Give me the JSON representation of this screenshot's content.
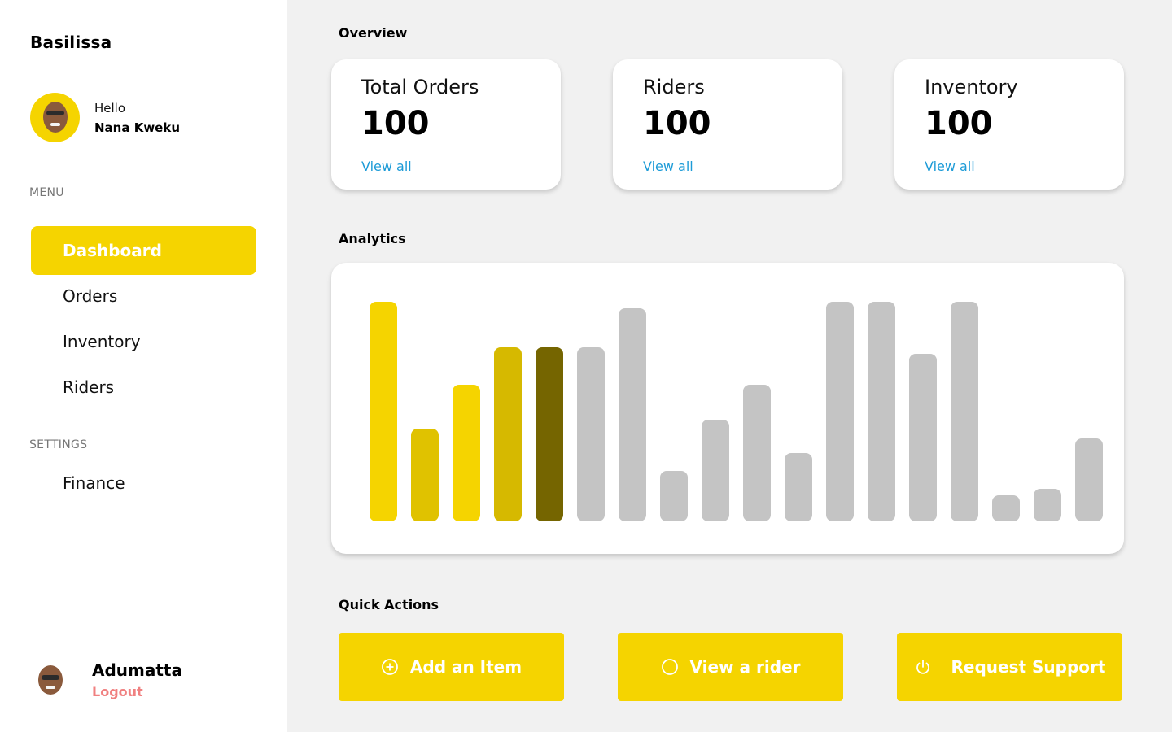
{
  "sidebar": {
    "brand": "Basilissa",
    "user": {
      "greeting": "Hello",
      "name": "Nana Kweku"
    },
    "menu_label": "MENU",
    "menu_items": [
      {
        "label": "Dashboard",
        "active": true
      },
      {
        "label": "Orders",
        "active": false
      },
      {
        "label": "Inventory",
        "active": false
      },
      {
        "label": "Riders",
        "active": false
      }
    ],
    "settings_label": "SETTINGS",
    "settings_items": [
      {
        "label": "Finance"
      }
    ],
    "footer": {
      "name": "Adumatta",
      "logout": "Logout"
    }
  },
  "overview": {
    "heading": "Overview",
    "cards": [
      {
        "title": "Total Orders",
        "value": "100",
        "link": "View all"
      },
      {
        "title": "Riders",
        "value": "100",
        "link": "View all"
      },
      {
        "title": "Inventory",
        "value": "100",
        "link": "View all"
      }
    ]
  },
  "analytics": {
    "heading": "Analytics"
  },
  "chart_data": {
    "type": "bar",
    "values": [
      270,
      114,
      168,
      214,
      214,
      214,
      262,
      62,
      125,
      168,
      84,
      270,
      270,
      206,
      270,
      32,
      40,
      102
    ],
    "colors": [
      "#f5d400",
      "#e0c200",
      "#f5d400",
      "#d6b900",
      "#756500",
      "#c4c4c4",
      "#c4c4c4",
      "#c4c4c4",
      "#c4c4c4",
      "#c4c4c4",
      "#c4c4c4",
      "#c4c4c4",
      "#c4c4c4",
      "#c4c4c4",
      "#c4c4c4",
      "#c4c4c4",
      "#c4c4c4",
      "#c4c4c4"
    ],
    "ylim": [
      0,
      270
    ],
    "grid": false,
    "legend": "none"
  },
  "quick_actions": {
    "heading": "Quick Actions",
    "buttons": [
      {
        "label": "Add an Item",
        "icon": "plus-circle-icon"
      },
      {
        "label": "View a rider",
        "icon": "circle-icon"
      },
      {
        "label": "Request Support",
        "icon": "power-icon"
      }
    ]
  },
  "colors": {
    "accent": "#f5d400",
    "link": "#1d9bd7",
    "logout": "#f08080",
    "bar_inactive": "#c4c4c4"
  }
}
